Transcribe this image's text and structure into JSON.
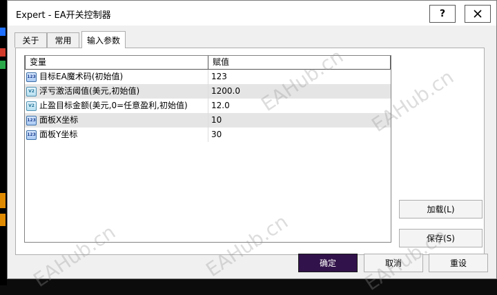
{
  "window": {
    "title": "Expert - EA开关控制器",
    "help_label": "?",
    "close_label": "✕"
  },
  "tabs": [
    {
      "label": "关于"
    },
    {
      "label": "常用"
    },
    {
      "label": "输入参数",
      "active": true
    }
  ],
  "grid": {
    "columns": [
      "变量",
      "赋值"
    ],
    "rows": [
      {
        "name": "目标EA魔术码(初始值)",
        "value": "123",
        "type_icon": "int-type-icon",
        "icon_text": "123"
      },
      {
        "name": "浮亏激活阈值(美元,初始值)",
        "value": "1200.0",
        "type_icon": "double-type-icon",
        "icon_text": "V2"
      },
      {
        "name": "止盈目标金额(美元,0=任意盈利,初始值)",
        "value": "12.0",
        "type_icon": "double-type-icon",
        "icon_text": "V2"
      },
      {
        "name": "面板X坐标",
        "value": "10",
        "type_icon": "int-type-icon",
        "icon_text": "123"
      },
      {
        "name": "面板Y坐标",
        "value": "30",
        "type_icon": "int-type-icon",
        "icon_text": "123"
      }
    ]
  },
  "buttons": {
    "load": "加载(L)",
    "save": "保存(S)",
    "ok": "确定",
    "cancel": "取消",
    "reset": "重设"
  },
  "watermark": "EAHub.cn"
}
